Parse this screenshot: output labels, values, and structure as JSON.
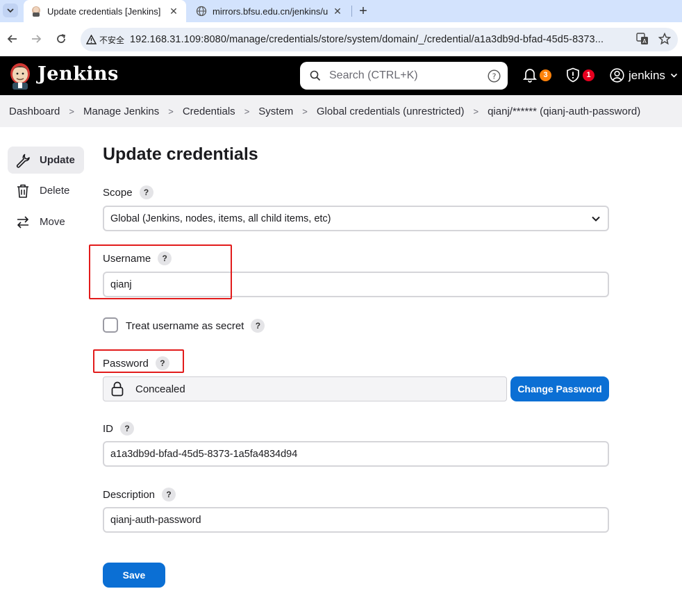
{
  "browser": {
    "tabs": [
      {
        "title": "Update credentials [Jenkins]",
        "active": true
      },
      {
        "title": "mirrors.bfsu.edu.cn/jenkins/u",
        "active": false
      }
    ],
    "security_label": "不安全",
    "url": "192.168.31.109:8080/manage/credentials/store/system/domain/_/credential/a1a3db9d-bfad-45d5-8373..."
  },
  "header": {
    "brand": "Jenkins",
    "search_placeholder": "Search (CTRL+K)",
    "notifications_count": "3",
    "security_count": "1",
    "user": "jenkins",
    "notifications_color": "#fe820a",
    "security_color": "#e6001f"
  },
  "breadcrumb": [
    "Dashboard",
    "Manage Jenkins",
    "Credentials",
    "System",
    "Global credentials (unrestricted)",
    "qianj/****** (qianj-auth-password)"
  ],
  "sidebar": {
    "items": [
      {
        "label": "Update",
        "icon": "wrench-icon"
      },
      {
        "label": "Delete",
        "icon": "trash-icon"
      },
      {
        "label": "Move",
        "icon": "move-arrows-icon"
      }
    ]
  },
  "form": {
    "title": "Update credentials",
    "scope": {
      "label": "Scope",
      "value": "Global (Jenkins, nodes, items, all child items, etc)"
    },
    "username": {
      "label": "Username",
      "value": "qianj"
    },
    "treat_secret": {
      "label": "Treat username as secret",
      "checked": false
    },
    "password": {
      "label": "Password",
      "value": "Concealed",
      "change_label": "Change Password"
    },
    "id": {
      "label": "ID",
      "value": "a1a3db9d-bfad-45d5-8373-1a5fa4834d94"
    },
    "description": {
      "label": "Description",
      "value": "qianj-auth-password"
    },
    "help_glyph": "?",
    "save_label": "Save"
  },
  "colors": {
    "accent": "#0b6fd4",
    "annotation": "#e21b1b"
  }
}
